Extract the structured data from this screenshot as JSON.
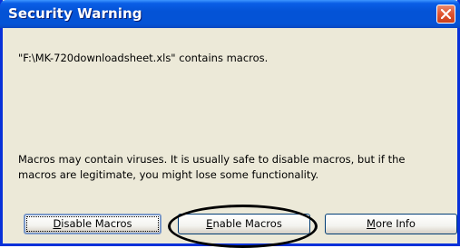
{
  "dialog": {
    "title": "Security Warning",
    "file_message": "\"F:\\MK-720downloadsheet.xls\" contains macros.",
    "warning_line1": "Macros may contain viruses. It is usually safe to disable macros, but if the",
    "warning_line2": "macros are legitimate, you might lose some functionality."
  },
  "buttons": {
    "disable_mnemonic": "D",
    "disable_rest": "isable Macros",
    "enable_mnemonic": "E",
    "enable_rest": "nable Macros",
    "more_mnemonic": "M",
    "more_rest": "ore Info"
  },
  "icons": {
    "close": "close-icon"
  },
  "colors": {
    "titlebar": "#0453d6",
    "window_bg": "#ece9d8",
    "close_button": "#e0532f",
    "annotation_circle": "#000000"
  }
}
